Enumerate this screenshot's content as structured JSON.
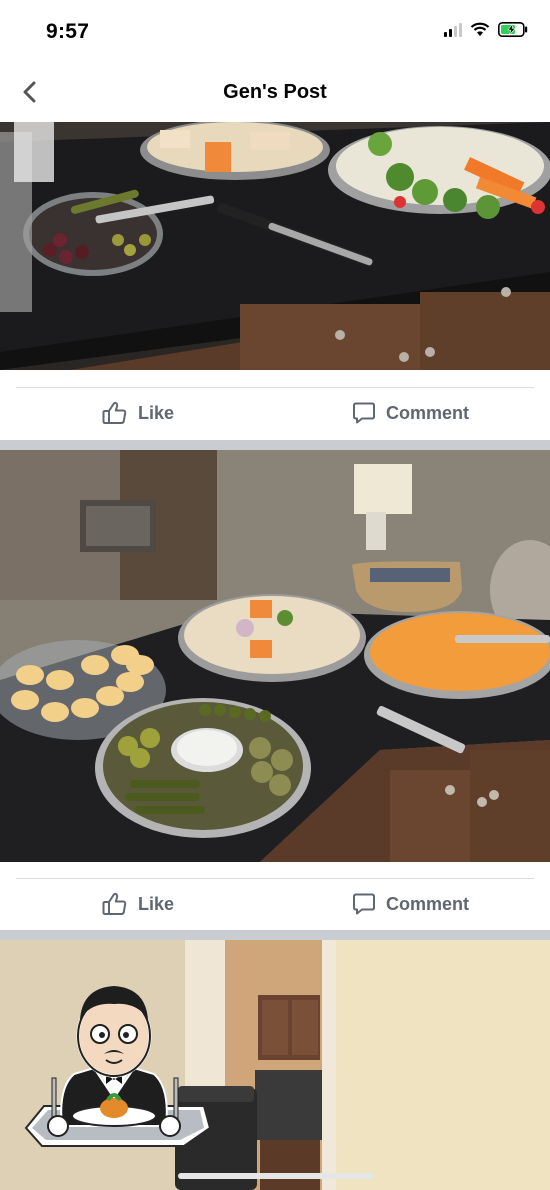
{
  "status_bar": {
    "time": "9:57",
    "icons": [
      "cellular-signal-icon",
      "wifi-icon",
      "battery-charging-icon"
    ]
  },
  "nav": {
    "back_icon": "chevron-left-icon",
    "title": "Gen's Post"
  },
  "posts": [
    {
      "actions": {
        "like_label": "Like",
        "comment_label": "Comment"
      }
    },
    {
      "actions": {
        "like_label": "Like",
        "comment_label": "Comment"
      }
    }
  ],
  "colors": {
    "action_text": "#606770",
    "separator": "#c9ccd1",
    "battery_fill": "#30d158"
  }
}
